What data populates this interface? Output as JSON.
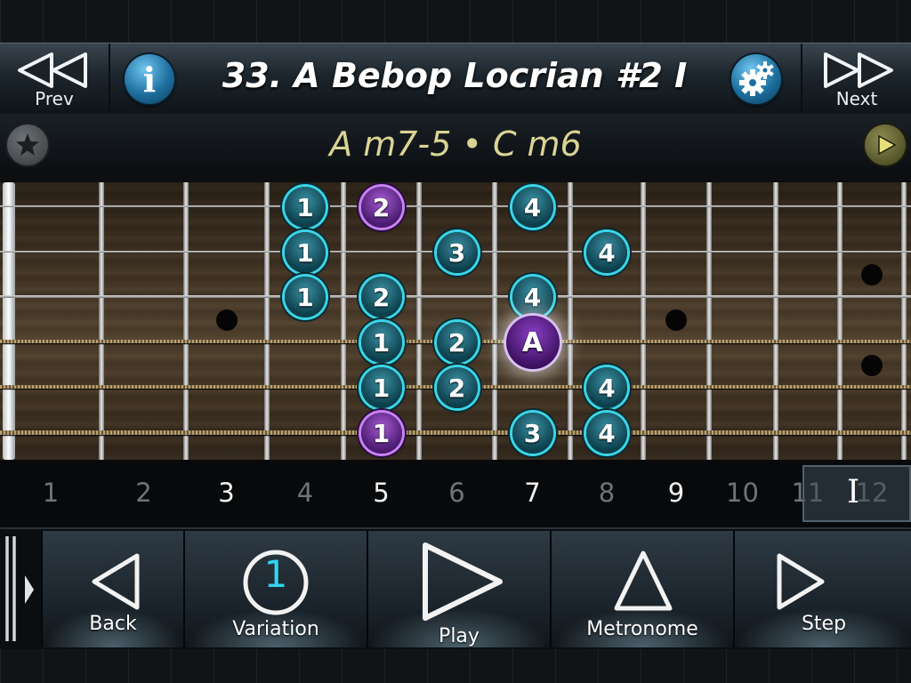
{
  "header": {
    "prev_label": "Prev",
    "next_label": "Next",
    "title": "33. A Bebop Locrian #2 I"
  },
  "chord_bar": {
    "chords": "A m7-5 • C m6"
  },
  "fretboard": {
    "strings": 6,
    "frets": 12,
    "inlays": [
      {
        "fret": 3,
        "gap": 3
      },
      {
        "fret": 9,
        "gap": 3
      },
      {
        "fret": 12,
        "gap": 2
      },
      {
        "fret": 12,
        "gap": 4
      }
    ],
    "notes": [
      {
        "string": 1,
        "fret": 4,
        "label": "1",
        "style": "blue"
      },
      {
        "string": 1,
        "fret": 5,
        "label": "2",
        "style": "purple"
      },
      {
        "string": 1,
        "fret": 7,
        "label": "4",
        "style": "blue"
      },
      {
        "string": 2,
        "fret": 4,
        "label": "1",
        "style": "blue"
      },
      {
        "string": 2,
        "fret": 6,
        "label": "3",
        "style": "blue"
      },
      {
        "string": 2,
        "fret": 8,
        "label": "4",
        "style": "blue"
      },
      {
        "string": 3,
        "fret": 4,
        "label": "1",
        "style": "blue"
      },
      {
        "string": 3,
        "fret": 5,
        "label": "2",
        "style": "blue"
      },
      {
        "string": 3,
        "fret": 7,
        "label": "4",
        "style": "blue"
      },
      {
        "string": 4,
        "fret": 5,
        "label": "1",
        "style": "blue"
      },
      {
        "string": 4,
        "fret": 6,
        "label": "2",
        "style": "blue"
      },
      {
        "string": 4,
        "fret": 7,
        "label": "A",
        "style": "root"
      },
      {
        "string": 5,
        "fret": 5,
        "label": "1",
        "style": "blue"
      },
      {
        "string": 5,
        "fret": 6,
        "label": "2",
        "style": "blue"
      },
      {
        "string": 5,
        "fret": 8,
        "label": "4",
        "style": "blue"
      },
      {
        "string": 6,
        "fret": 5,
        "label": "1",
        "style": "purple"
      },
      {
        "string": 6,
        "fret": 7,
        "label": "3",
        "style": "blue"
      },
      {
        "string": 6,
        "fret": 8,
        "label": "4",
        "style": "blue"
      }
    ]
  },
  "fret_numbers": {
    "labels": [
      "1",
      "2",
      "3",
      "4",
      "5",
      "6",
      "7",
      "8",
      "9",
      "10",
      "11",
      "12"
    ],
    "marked": [
      "3",
      "5",
      "7",
      "9"
    ],
    "position_cursor": "I"
  },
  "toolbar": {
    "back_label": "Back",
    "variation_label": "Variation",
    "variation_value": "1",
    "play_label": "Play",
    "metronome_label": "Metronome",
    "step_label": "Step"
  },
  "colors": {
    "note_blue": "#3bd5e6",
    "note_purple": "#c783f2",
    "root_purple": "#6a2a9c",
    "chord_text": "#d9d493"
  }
}
